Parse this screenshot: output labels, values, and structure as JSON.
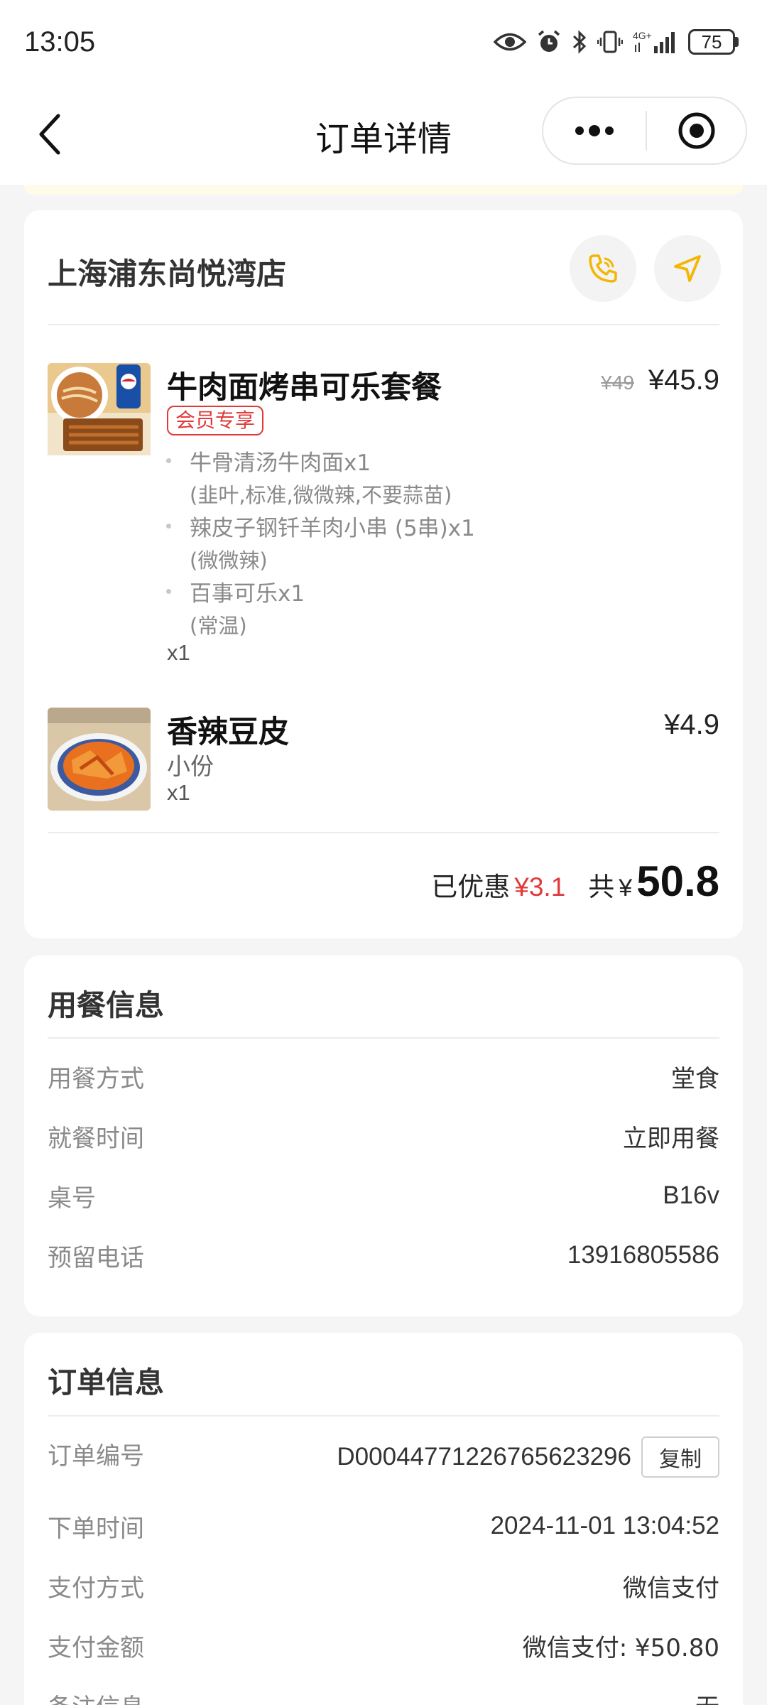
{
  "status_bar": {
    "time": "13:05",
    "battery": "75"
  },
  "nav": {
    "title": "订单详情"
  },
  "store": {
    "name": "上海浦东尚悦湾店",
    "items": [
      {
        "name": "牛肉面烤串可乐套餐",
        "old_price": "¥49",
        "price": "¥45.9",
        "tag": "会员专享",
        "sub_items": [
          {
            "name": "牛骨清汤牛肉面x1",
            "option": "(韭叶,标准,微微辣,不要蒜苗)"
          },
          {
            "name": "辣皮子钢钎羊肉小串 (5串)x1",
            "option": "(微微辣)"
          },
          {
            "name": "百事可乐x1",
            "option": "(常温)"
          }
        ],
        "qty": "x1"
      },
      {
        "name": "香辣豆皮",
        "price": "¥4.9",
        "spec": "小份",
        "qty": "x1"
      }
    ],
    "summary": {
      "discount_label": "已优惠",
      "discount": "¥3.1",
      "total_label": "共",
      "currency": "¥",
      "total": "50.8"
    }
  },
  "dining": {
    "title": "用餐信息",
    "rows": [
      {
        "label": "用餐方式",
        "value": "堂食"
      },
      {
        "label": "就餐时间",
        "value": "立即用餐"
      },
      {
        "label": "桌号",
        "value": "B16v"
      },
      {
        "label": "预留电话",
        "value": "13916805586"
      }
    ]
  },
  "order": {
    "title": "订单信息",
    "copy_label": "复制",
    "rows": [
      {
        "label": "订单编号",
        "value": "D0004477122676562329​6"
      },
      {
        "label": "下单时间",
        "value": "2024-11-01 13:04:52"
      },
      {
        "label": "支付方式",
        "value": "微信支付"
      },
      {
        "label": "支付金额",
        "value": "微信支付: ¥50.80"
      },
      {
        "label": "备注信息",
        "value": "无"
      }
    ]
  },
  "colors": {
    "accent": "#f2b705",
    "discount": "#e03a3a",
    "background": "#f5f5f5"
  }
}
